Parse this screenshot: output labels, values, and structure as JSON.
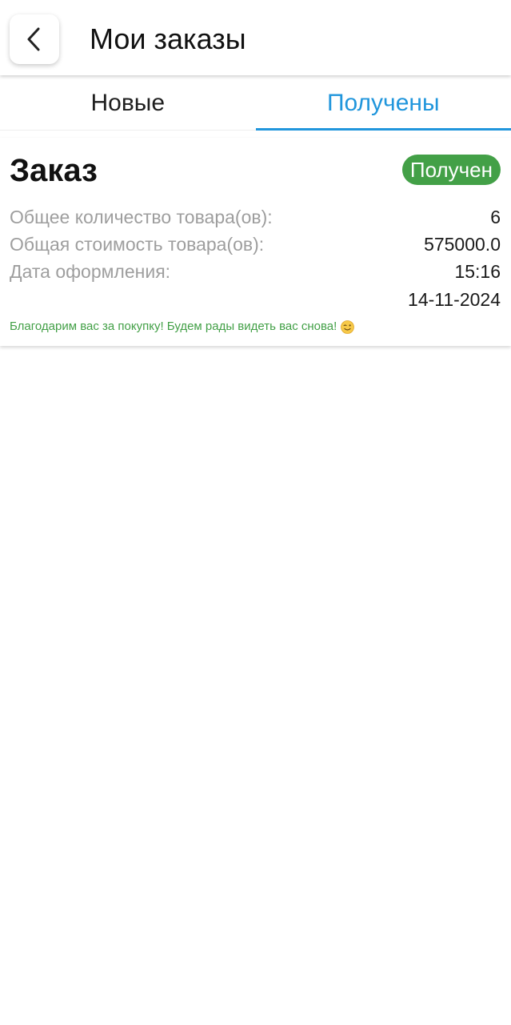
{
  "header": {
    "title": "Мои заказы",
    "back_icon": "chevron-left-icon"
  },
  "tabs": [
    {
      "label": "Новые",
      "active": false
    },
    {
      "label": "Получены",
      "active": true
    }
  ],
  "order": {
    "title": "Заказ",
    "status": "Получен",
    "rows": [
      {
        "label": "Общее количество товара(ов):",
        "value": "6"
      },
      {
        "label": "Общая стоимость товара(ов):",
        "value": "575000.0"
      },
      {
        "label": "Дата оформления:",
        "value": "15:16"
      },
      {
        "label": "",
        "value": "14-11-2024"
      }
    ],
    "thanks": "Благодарим вас за покупку! Будем рады видеть вас снова!",
    "thanks_icon": "wink-emoji-icon"
  },
  "colors": {
    "accent": "#2196dc",
    "status_green": "#43a047",
    "label_gray": "#9e9e9e"
  }
}
